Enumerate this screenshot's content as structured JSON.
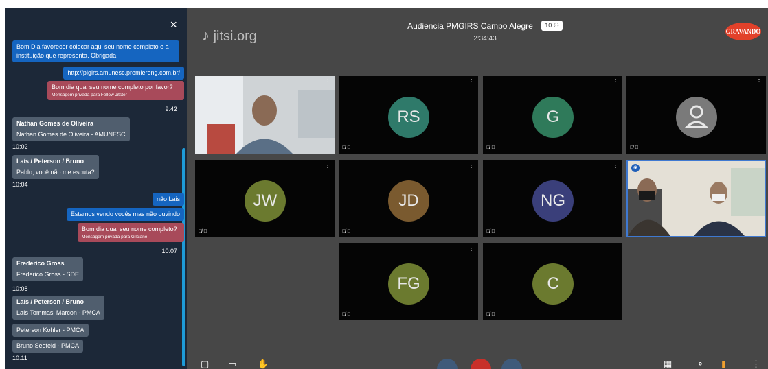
{
  "chat": {
    "close_icon": "×",
    "messages": [
      {
        "text": "Bom Dia favorecer colocar aqui seu nome completo e a instituição que representa. Obrigada"
      },
      {
        "text": "http://pigirs.amunesc.premiereng.com.br/"
      },
      {
        "text": "Bom dia qual seu nome completo por favor?",
        "note": "Mensagem privada para Fellow Jitster",
        "time": "9:42"
      },
      {
        "sender": "Nathan Gomes de Oliveira",
        "text": "Nathan Gomes de Oliveira - AMUNESC",
        "time": "10:02"
      },
      {
        "sender": "Laís / Peterson / Bruno",
        "text": "Pablo, você não me escuta?",
        "time": "10:04"
      },
      {
        "text": "não Lais"
      },
      {
        "text": "Estamos vendo vocês mas não ouvindo"
      },
      {
        "text": "Bom dia qual seu nome completo?",
        "note": "Mensagem privada para Gilciane",
        "time": "10:07"
      },
      {
        "sender": "Frederico Gross",
        "text": "Frederico Gross - SDE",
        "time": "10:08"
      },
      {
        "sender": "Laís / Peterson / Bruno",
        "text": "Laís Tommasi Marcon - PMCA"
      },
      {
        "text": "Peterson Kohler - PMCA"
      },
      {
        "text": "Bruno Seefeld - PMCA",
        "time": "10:11"
      }
    ]
  },
  "header": {
    "logo": "jitsi.org",
    "meeting_title": "Audiencia PMGIRS Campo Alegre",
    "participant_count": "10",
    "duration": "2:34:43",
    "recording_label": "GRAVANDO"
  },
  "tiles": [
    {
      "initials": "",
      "color": "#d8d8d8"
    },
    {
      "initials": "RS",
      "color": "#2f7a6a"
    },
    {
      "initials": "G",
      "color": "#2f7a5a"
    },
    {
      "initials": "",
      "color": "#7a7a7a"
    },
    {
      "initials": "JW",
      "color": "#6b7a2f"
    },
    {
      "initials": "JD",
      "color": "#7a5a2f"
    },
    {
      "initials": "NG",
      "color": "#3a3f7a"
    },
    {
      "initials": "",
      "color": "#e0e0e0"
    },
    {
      "initials": "FG",
      "color": "#6b7a2f"
    },
    {
      "initials": "C",
      "color": "#6b7a2f"
    }
  ]
}
